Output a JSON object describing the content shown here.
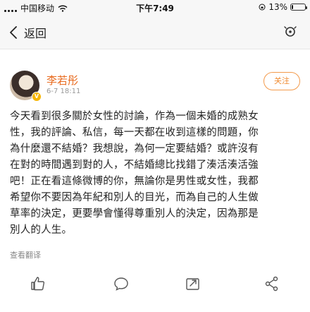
{
  "status_bar": {
    "carrier": "中国移动",
    "time": "下午7:49",
    "battery": "13%",
    "battery_level": 0.13
  },
  "nav": {
    "back_label": "返回",
    "icons": [
      "back-chevron-icon",
      "more-icon"
    ]
  },
  "post": {
    "username": "李若彤",
    "timestamp": "6-7 18:11",
    "follow_label": "关注",
    "verified_badge": "V",
    "lines": [
      "今天看到很多關於女性的討論，作為一個未婚的成熟女",
      "性，我的評論、私信，每一天都在收到這樣的問題，你",
      "為什麼還不結婚？我想說，為何一定要結婚？或許沒有",
      "在對的時間遇到對的人，不結婚總比找錯了湊活湊活強",
      "吧！正在看這條微博的你，無論你是男性或女性，我都",
      "希望你不要因為年紀和別人的目光，而為自己的人生做",
      "草率的決定，更要學會懂得尊重別人的決定，因為那是",
      "別人的人生。"
    ],
    "translate_label": "查看翻译"
  },
  "actions": [
    "like-icon",
    "comment-icon",
    "repost-icon",
    "share-icon"
  ],
  "colors": {
    "username": "#e86b1f",
    "follow": "#f08a2f",
    "badge": "#f7b500"
  }
}
